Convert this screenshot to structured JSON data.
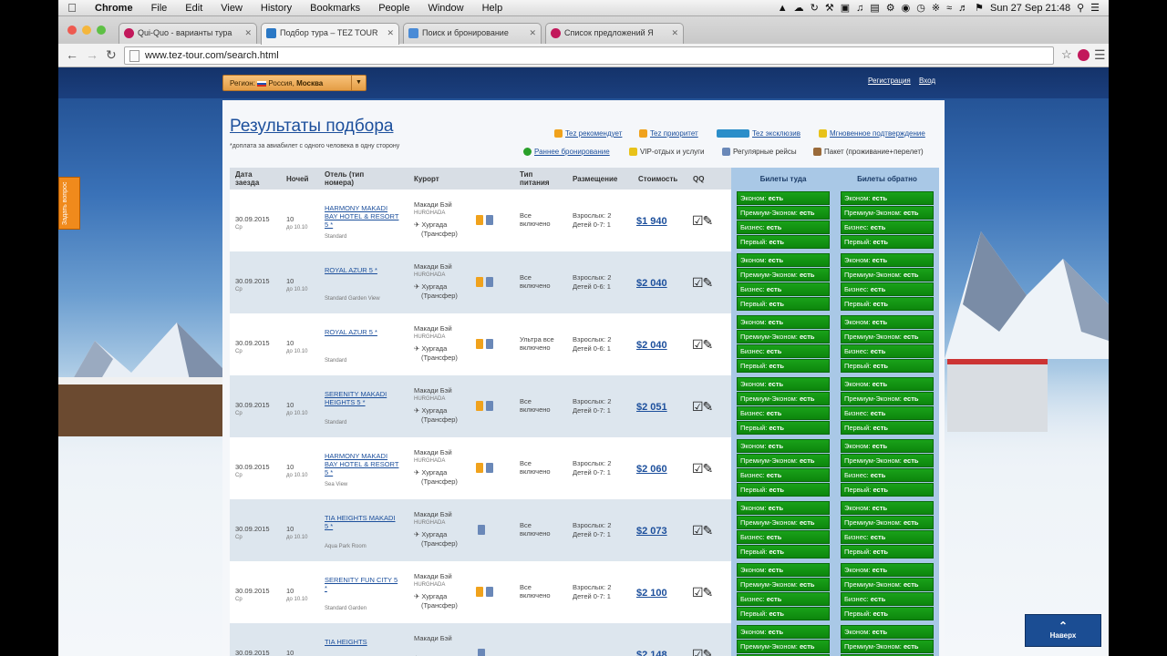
{
  "menubar": {
    "items": [
      "Chrome",
      "File",
      "Edit",
      "View",
      "History",
      "Bookmarks",
      "People",
      "Window",
      "Help"
    ],
    "clock": "Sun 27 Sep  21:48"
  },
  "tabs": [
    {
      "label": "Qui-Quo - варианты тура"
    },
    {
      "label": "Подбор тура – TEZ TOUR"
    },
    {
      "label": "Поиск и бронирование"
    },
    {
      "label": "Список предложений Я"
    }
  ],
  "address": {
    "url": "www.tez-tour.com/search.html"
  },
  "page": {
    "region_label": "Регион:",
    "region_value": "Россия,",
    "region_city": "Москва",
    "register": "Регистрация",
    "login": "Вход",
    "title": "Результаты подбора",
    "note": "*доплата за авиабилет с одного человека в одну сторону",
    "up_button": "Наверх",
    "side_widget": "Задать вопрос"
  },
  "legend": [
    {
      "label": "Tez рекомендует",
      "color": "#f0a21c"
    },
    {
      "label": "Tez приоритет",
      "color": "#f0a21c"
    },
    {
      "label": "Tez эксклюзив",
      "color": "#2b8ec9"
    },
    {
      "label": "Мгновенное подтверждение",
      "color": "#e8c21a"
    },
    {
      "label": "Раннее бронирование",
      "color": "#2aa02a"
    },
    {
      "label": "VIP-отдых и услуги",
      "color": "#e8c21a"
    },
    {
      "label": "Регулярные рейсы",
      "color": "#6a88b8"
    },
    {
      "label": "Пакет (проживание+перелет)",
      "color": "#9a6a3a"
    }
  ],
  "table": {
    "headers": {
      "date": "Дата заезда",
      "nights": "Ночей",
      "hotel": "Отель (тип номера)",
      "resort": "Курорт",
      "meal": "Тип питания",
      "accommodation": "Размещение",
      "price": "Стоимость",
      "qq": "QQ",
      "tix_there": "Билеты туда",
      "tix_back": "Билеты обратно"
    },
    "rows": [
      {
        "date": "30.09.2015",
        "dow": "Ср",
        "nights": "10",
        "till": "до 10.10",
        "hotel": "HARMONY MAKADI BAY HOTEL & RESORT 5 *",
        "room": "Standard",
        "resort": "Макади Бэй",
        "resort_sub": "HURGHADA",
        "airport": "Хургада",
        "transfer": "(Трансфер)",
        "meal": "Все включено",
        "adults": "Взрослых: 2",
        "kids": "Детей 0-7: 1",
        "price": "$1 940"
      },
      {
        "date": "30.09.2015",
        "dow": "Ср",
        "nights": "10",
        "till": "до 10.10",
        "hotel": "ROYAL AZUR 5 *",
        "room": "Standard Garden View",
        "resort": "Макади Бэй",
        "resort_sub": "HURGHADA",
        "airport": "Хургада",
        "transfer": "(Трансфер)",
        "meal": "Все включено",
        "adults": "Взрослых: 2",
        "kids": "Детей 0-6: 1",
        "price": "$2 040"
      },
      {
        "date": "30.09.2015",
        "dow": "Ср",
        "nights": "10",
        "till": "до 10.10",
        "hotel": "ROYAL AZUR 5 *",
        "room": "Standard",
        "resort": "Макади Бэй",
        "resort_sub": "HURGHADA",
        "airport": "Хургада",
        "transfer": "(Трансфер)",
        "meal": "Ультра все включено",
        "adults": "Взрослых: 2",
        "kids": "Детей 0-6: 1",
        "price": "$2 040"
      },
      {
        "date": "30.09.2015",
        "dow": "Ср",
        "nights": "10",
        "till": "до 10.10",
        "hotel": "SERENITY MAKADI HEIGHTS 5 *",
        "room": "Standard",
        "resort": "Макади Бэй",
        "resort_sub": "HURGHADA",
        "airport": "Хургада",
        "transfer": "(Трансфер)",
        "meal": "Все включено",
        "adults": "Взрослых: 2",
        "kids": "Детей 0-7: 1",
        "price": "$2 051"
      },
      {
        "date": "30.09.2015",
        "dow": "Ср",
        "nights": "10",
        "till": "до 10.10",
        "hotel": "HARMONY MAKADI BAY HOTEL & RESORT 5 *",
        "room": "Sea View",
        "resort": "Макади Бэй",
        "resort_sub": "HURGHADA",
        "airport": "Хургада",
        "transfer": "(Трансфер)",
        "meal": "Все включено",
        "adults": "Взрослых: 2",
        "kids": "Детей 0-7: 1",
        "price": "$2 060"
      },
      {
        "date": "30.09.2015",
        "dow": "Ср",
        "nights": "10",
        "till": "до 10.10",
        "hotel": "TIA HEIGHTS MAKADI 5 *",
        "room": "Aqua Park Room",
        "resort": "Макади Бэй",
        "resort_sub": "HURGHADA",
        "airport": "Хургада",
        "transfer": "(Трансфер)",
        "meal": "Все включено",
        "adults": "Взрослых: 2",
        "kids": "Детей 0-7: 1",
        "price": "$2 073"
      },
      {
        "date": "30.09.2015",
        "dow": "Ср",
        "nights": "10",
        "till": "до 10.10",
        "hotel": "SERENITY FUN CITY 5 *",
        "room": "Standard Garden",
        "resort": "Макади Бэй",
        "resort_sub": "HURGHADA",
        "airport": "Хургада",
        "transfer": "(Трансфер)",
        "meal": "Все включено",
        "adults": "Взрослых: 2",
        "kids": "Детей 0-7: 1",
        "price": "$2 100"
      },
      {
        "date": "30.09.2015",
        "dow": "",
        "nights": "10",
        "till": "",
        "hotel": "TIA HEIGHTS",
        "room": "",
        "resort": "Макади Бэй",
        "resort_sub": "",
        "airport": "",
        "transfer": "",
        "meal": "",
        "adults": "",
        "kids": "",
        "price": "$2 148"
      }
    ],
    "tickets": [
      {
        "label": "Эконом:",
        "status": "есть"
      },
      {
        "label": "Премиум-Эконом:",
        "status": "есть"
      },
      {
        "label": "Бизнес:",
        "status": "есть"
      },
      {
        "label": "Первый:",
        "status": "есть"
      }
    ]
  },
  "colors": {
    "link": "#1c4f9c",
    "ticket_green": "#1aa21a",
    "ticket_col": "#a9c8e6",
    "topbar": "#14336a"
  }
}
